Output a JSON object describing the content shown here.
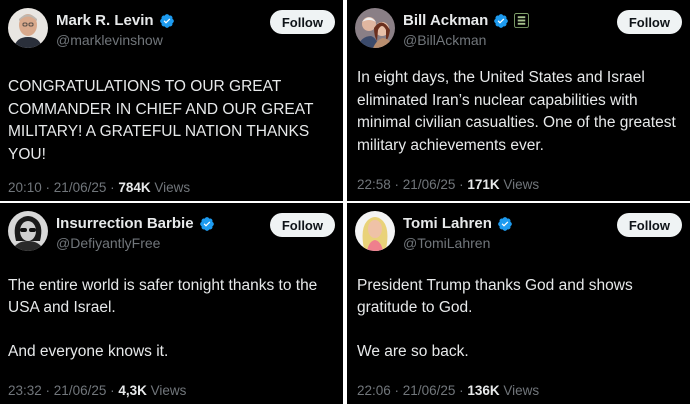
{
  "tweets": [
    {
      "name": "Mark R. Levin",
      "handle": "@marklevinshow",
      "follow_label": "Follow",
      "text": "CONGRATULATIONS TO OUR GREAT COMMANDER IN CHIEF AND OUR GREAT MILITARY!  A GRATEFUL NATION THANKS YOU!",
      "time": "20:10",
      "date": "21/06/25",
      "views_count": "784K",
      "views_label": "Views"
    },
    {
      "name": "Bill Ackman",
      "handle": "@BillAckman",
      "follow_label": "Follow",
      "text": "In eight days, the United States and Israel eliminated Iran’s nuclear capabilities with minimal civilian casualties. One of the greatest military achievements ever.",
      "time": "22:58",
      "date": "21/06/25",
      "views_count": "171K",
      "views_label": "Views"
    },
    {
      "name": "Insurrection Barbie",
      "handle": "@DefiyantlyFree",
      "follow_label": "Follow",
      "text": "The entire world is safer tonight thanks to the USA and Israel.\n\nAnd everyone knows it.",
      "time": "23:32",
      "date": "21/06/25",
      "views_count": "4,3K",
      "views_label": "Views"
    },
    {
      "name": "Tomi Lahren",
      "handle": "@TomiLahren",
      "follow_label": "Follow",
      "text": "President Trump thanks God and shows gratitude to God.\n\nWe are so back.",
      "time": "22:06",
      "date": "21/06/25",
      "views_count": "136K",
      "views_label": "Views"
    }
  ],
  "separator": " · ",
  "colors": {
    "verified": "#1d9bf0",
    "muted": "#71767b",
    "text": "#e7e9ea",
    "background": "#000000",
    "button": "#eff3f4"
  }
}
